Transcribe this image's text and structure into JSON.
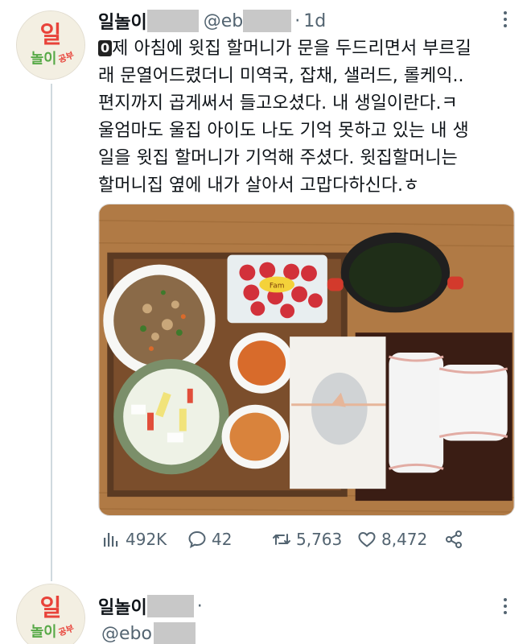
{
  "tweet": {
    "author_name": "일놀이",
    "handle": "@eb",
    "separator": "·",
    "time": "1d",
    "text_zero_emoji": "0",
    "text_lines": [
      "제 아침에 윗집 할머니가 문을 두드리면서 부르길",
      "래 문열어드렸더니 미역국, 잡채, 샐러드, 롤케익..",
      "편지까지 곱게써서 들고오셨다. 내 생일이란다.ㅋ",
      "울엄마도 울집 아이도 나도 기억 못하고 있는 내 생",
      "일을 윗집 할머니가 기억해 주셨다. 윗집할머니는",
      "할머니집 옆에 내가 살아서 고맙다하신다.ㅎ"
    ],
    "stats": {
      "views": "492K",
      "replies": "42",
      "retweets": "5,763",
      "likes": "8,472"
    }
  },
  "reply_tweet": {
    "author_name": "일놀이",
    "name_suffix": "·",
    "handle": "@ebo"
  },
  "avatar_text": {
    "top": "일",
    "middle": "놀이",
    "side": "공부"
  },
  "photo_label": "Fam",
  "icons": {
    "views": "bar-chart-icon",
    "reply": "speech-bubble-icon",
    "retweet": "retweet-icon",
    "like": "heart-icon",
    "share": "share-icon",
    "more": "more-dots-icon"
  },
  "colors": {
    "text_primary": "#0f1419",
    "text_secondary": "#536471",
    "thread_line": "#cfd9de",
    "avatar_red": "#e8433a",
    "avatar_green": "#57a947"
  }
}
